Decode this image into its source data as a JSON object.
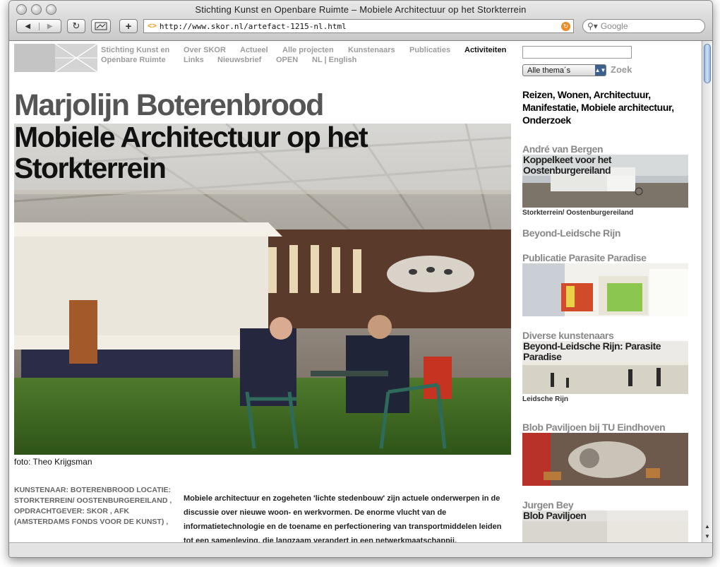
{
  "window": {
    "title": "Stichting Kunst en Openbare Ruimte – Mobiele Architectuur op het Storkterrein",
    "url": "http://www.skor.nl/artefact-1215-nl.html",
    "search_placeholder": "Google"
  },
  "topnav": {
    "row1": [
      "Stichting Kunst en",
      "Over SKOR",
      "Actueel",
      "Alle projecten",
      "Kunstenaars",
      "Publicaties",
      "Activiteiten"
    ],
    "row2": [
      "Openbare Ruimte",
      "Links",
      "Nieuwsbrief",
      "OPEN",
      "NL | English"
    ]
  },
  "search": {
    "select_value": "Alle thema´s",
    "button": "Zoek"
  },
  "tags": {
    "items": [
      "Reizen",
      "Wonen",
      "Architectuur",
      "Manifestatie",
      "Mobiele architectuur",
      "Onderzoek"
    ],
    "separator": ", "
  },
  "article": {
    "artist": "Marjolijn Boterenbrood",
    "title": "Mobiele Architectuur op het Storkterrein",
    "photo_credit": "foto: Theo Krijgsman",
    "meta": "KUNSTENAAR:  BOTERENBROOD LOCATIE:  STORKTERREIN/ OOSTENBURGEREILAND , OPDRACHTGEVER:  SKOR , AFK (AMSTERDAMS FONDS VOOR DE KUNST) ,",
    "body": "Mobiele architectuur en zogeheten 'lichte stedenbouw' zijn actuele onderwerpen in de discussie over nieuwe woon- en werkvormen. De enorme vlucht van de informatietechnologie en de toename en perfectionering van transportmiddelen leiden tot een samenleving, die langzaam verandert in een netwerkmaatschappij."
  },
  "sidebar": [
    {
      "heading": "André van Bergen",
      "overlay": "Koppelkeet voor het Oostenburgereiland",
      "caption": "Storkterrein/ Oostenburgereiland"
    },
    {
      "heading": "Beyond-Leidsche Rijn",
      "overlay": "",
      "caption": ""
    },
    {
      "heading": "Publicatie Parasite Paradise",
      "overlay": "",
      "caption": ""
    },
    {
      "heading": "Diverse kunstenaars",
      "overlay": "Beyond-Leidsche Rijn: Parasite Paradise",
      "caption": "Leidsche Rijn"
    },
    {
      "heading": "Blob Paviljoen bij TU Eindhoven",
      "overlay": "",
      "caption": ""
    },
    {
      "heading": "Jurgen Bey",
      "overlay": "Blob Paviljoen",
      "caption": ""
    }
  ],
  "colors": {
    "nav_text": "#9c9c9c",
    "nav_active": "#111111",
    "heading_gray": "#555555"
  }
}
